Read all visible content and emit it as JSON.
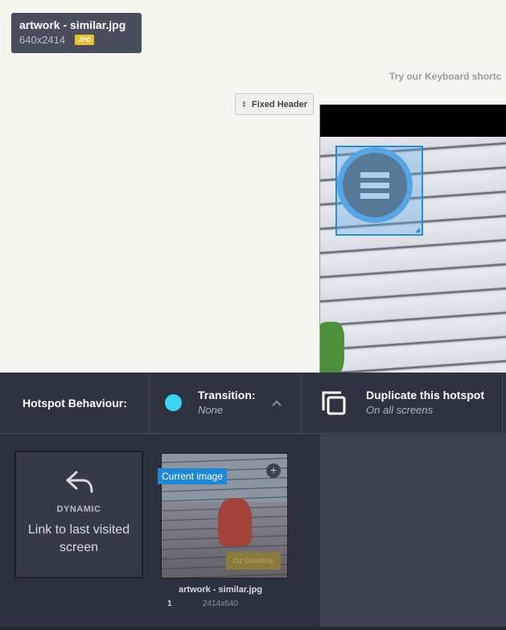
{
  "file": {
    "name": "artwork - similar.jpg",
    "dims": "640x2414",
    "type": "JPG"
  },
  "hint": "Try our Keyboard shortc",
  "fixed_header": {
    "label": "Fixed Header"
  },
  "behaviour": {
    "label": "Hotspot Behaviour:",
    "transition": {
      "title": "Transition:",
      "value": "None",
      "dot_color": "#3ad4f5"
    },
    "duplicate": {
      "title": "Duplicate this hotspot",
      "value": "On all screens"
    }
  },
  "dynamic": {
    "tag": "DYNAMIC",
    "desc": "Link to last visited screen"
  },
  "screen": {
    "current": "Current image",
    "sign": "Oz Gremlins",
    "name": "artwork - similar.jpg",
    "index": "1",
    "dims": "2414x640"
  },
  "colors": {
    "accent": "#1e87d6",
    "hotspot": "#2b8dd6",
    "badge": "#e8c12a"
  }
}
